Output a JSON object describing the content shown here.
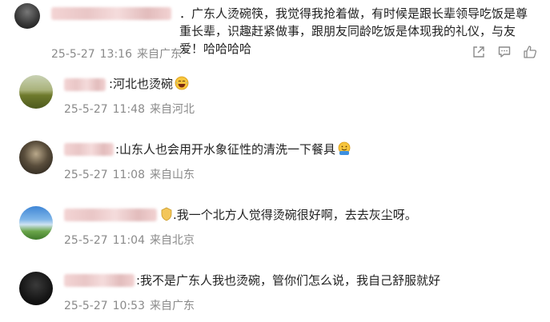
{
  "comments": [
    {
      "text": "．广东人烫碗筷，我觉得我抢着做，有时候是跟长辈领导吃饭是尊重长辈，识趣赶紧做事，跟朋友同龄吃饭是体现我的礼仪，与友爱！哈哈哈哈",
      "date": "25-5-27",
      "time": "13:16",
      "location": "来自广东",
      "avatar_color": "#3a3a3a"
    },
    {
      "text": ":河北也烫碗",
      "emoji": "laughing-emoji",
      "date": "25-5-27",
      "time": "11:48",
      "location": "来自河北",
      "avatar_color": "#7d8a3c"
    },
    {
      "text": ":山东人也会用开水象征性的清洗一下餐具",
      "emoji": "hugging-emoji",
      "date": "25-5-27",
      "time": "11:08",
      "location": "来自山东",
      "avatar_color": "#2e2a24"
    },
    {
      "text": ".我一个北方人觉得烫碗很好啊，去去灰尘呀。",
      "emoji": "badge-emoji",
      "date": "25-5-27",
      "time": "11:04",
      "location": "来自北京",
      "avatar_color": "#4f8ec9"
    },
    {
      "text": ":我不是广东人我也烫碗，管你们怎么说，我自己舒服就好",
      "date": "25-5-27",
      "time": "10:53",
      "location": "来自广东",
      "avatar_color": "#1c1c1c"
    }
  ],
  "actions": [
    {
      "icon": "share-icon"
    },
    {
      "icon": "comment-icon"
    },
    {
      "icon": "like-icon"
    }
  ]
}
